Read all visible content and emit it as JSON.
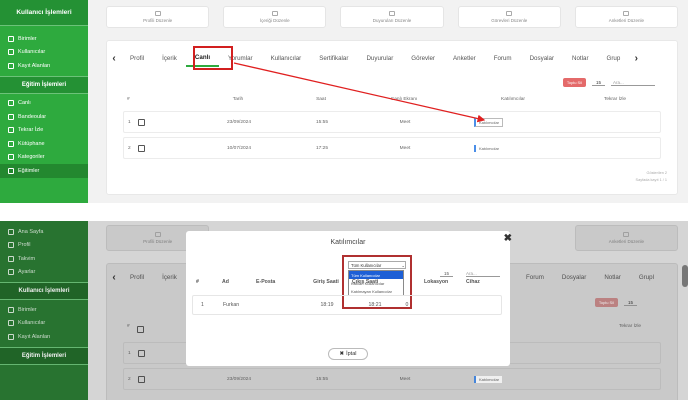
{
  "top": {
    "sidebar": {
      "header": "Kullanıcı İşlemleri",
      "items_a": [
        {
          "label": "Birimler",
          "icon": "building-icon"
        },
        {
          "label": "Kullanıcılar",
          "icon": "users-icon"
        },
        {
          "label": "Kayıt Alanları",
          "icon": "form-icon"
        }
      ],
      "section": "Eğitim İşlemleri",
      "items_b": [
        {
          "label": "Canlı",
          "icon": "live-icon"
        },
        {
          "label": "Bandeoular",
          "icon": "list-icon"
        },
        {
          "label": "Tekrar İzle",
          "icon": "replay-icon"
        },
        {
          "label": "Kütüphane",
          "icon": "library-icon"
        },
        {
          "label": "Kategoriler",
          "icon": "category-icon"
        },
        {
          "label": "Eğitimler",
          "icon": "book-icon"
        }
      ]
    },
    "cards": [
      "Profili Düzenle",
      "İçeriği Düzenle",
      "Duyuruları Düzenle",
      "Görevleri Düzenle",
      "Anketleri Düzenle"
    ],
    "tabs": [
      "Profil",
      "İçerik",
      "Canlı",
      "Yorumlar",
      "Kullanıcılar",
      "Sertifikalar",
      "Duyurular",
      "Görevler",
      "Anketler",
      "Forum",
      "Dosyalar",
      "Notlar",
      "Grup"
    ],
    "toolbar": {
      "delete_label": "Toplu Sil",
      "per_page": "15",
      "search_placeholder": "Ara..."
    },
    "table": {
      "headers": [
        "#",
        "Tarih",
        "Saat",
        "Canlı Ekranı",
        "Katılımcılar",
        "Tekrar İzle"
      ],
      "rows": [
        {
          "n": "1",
          "date": "23/09/2024",
          "time": "15:55",
          "screen": "Meet",
          "part": "Katılımcılar"
        },
        {
          "n": "2",
          "date": "10/07/2024",
          "time": "17:25",
          "screen": "Meet",
          "part": "Katılımcılar"
        }
      ]
    },
    "footer": {
      "line1": "Gösterilen 2",
      "line2": "Sayfada kayıt 1 / 1"
    }
  },
  "bottom": {
    "sidebar": {
      "items_top": [
        {
          "label": "Ana Sayfa",
          "icon": "home-icon"
        },
        {
          "label": "Profil",
          "icon": "user-icon"
        },
        {
          "label": "Takvim",
          "icon": "calendar-icon"
        },
        {
          "label": "Ayarlar",
          "icon": "gear-icon"
        }
      ],
      "header": "Kullanıcı İşlemleri",
      "items_a": [
        {
          "label": "Birimler",
          "icon": "building-icon"
        },
        {
          "label": "Kullanıcılar",
          "icon": "users-icon"
        },
        {
          "label": "Kayıt Alanları",
          "icon": "form-icon"
        }
      ],
      "section": "Eğitim İşlemleri"
    },
    "cards": [
      "Profili Düzenle",
      "Anketleri Düzenle"
    ],
    "tabs_left": [
      "Profil",
      "İçerik"
    ],
    "tabs_right": [
      "Forum",
      "Dosyalar",
      "Notlar",
      "Grupl"
    ],
    "toolbar": {
      "delete_label": "Toplu Sil",
      "per_page": "15"
    },
    "table": {
      "headers": [
        "#",
        "Tekrar İzle"
      ],
      "rows": [
        {
          "n": "1"
        },
        {
          "n": "2",
          "date": "23/09/2024",
          "time": "15:55",
          "screen": "Meet",
          "part": "Katılımcılar"
        }
      ]
    },
    "modal": {
      "title": "Katılımcılar",
      "close": "✖",
      "select_value": "Tüm Kullanıcılar",
      "options": [
        "Tüm Kullanıcılar",
        "Katılan Kullanıcılar",
        "Katılmayan Kullanıcılar"
      ],
      "per_page": "15",
      "search_placeholder": "Ara...",
      "headers": [
        "#",
        "Ad",
        "E-Posta",
        "Giriş Saati",
        "Çıkış Saati",
        "Lokasyon",
        "Cihaz"
      ],
      "row": {
        "n": "1",
        "name": "Furkan",
        "email": "",
        "in": "18:19",
        "out": "18:21",
        "loc": "0",
        "device": ""
      },
      "cancel_label": "İptal"
    }
  }
}
